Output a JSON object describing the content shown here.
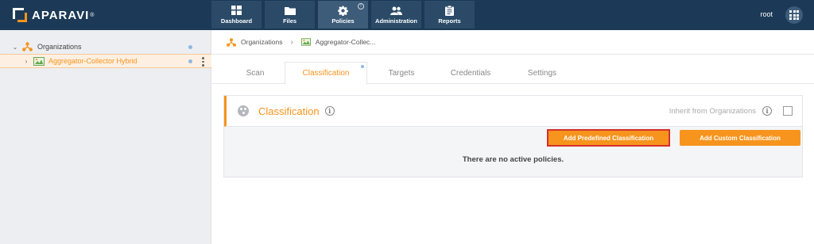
{
  "brand": {
    "name": "APARAVI",
    "reg": "®"
  },
  "nav": {
    "items": [
      {
        "label": "Dashboard",
        "icon": "dashboard-icon"
      },
      {
        "label": "Files",
        "icon": "folder-icon"
      },
      {
        "label": "Policies",
        "icon": "gear-icon",
        "active": true,
        "info": "!"
      },
      {
        "label": "Administration",
        "icon": "users-icon"
      },
      {
        "label": "Reports",
        "icon": "clipboard-icon"
      }
    ]
  },
  "user": {
    "name": "root"
  },
  "tree": {
    "root": {
      "label": "Organizations",
      "chevron": "⌄"
    },
    "child": {
      "label": "Aggregator-Collector Hybrid",
      "chevron": "›"
    }
  },
  "breadcrumb": {
    "items": [
      "Organizations",
      "Aggregator-Collec..."
    ],
    "separator": "›"
  },
  "tabs": [
    "Scan",
    "Classification",
    "Targets",
    "Credentials",
    "Settings"
  ],
  "active_tab": "Classification",
  "panel": {
    "title": "Classification",
    "info": "i",
    "inherit_label": "Inherit from Organizations",
    "add_predefined_label": "Add Predefined Classification",
    "add_custom_label": "Add Custom Classification",
    "empty_message": "There are no active policies."
  },
  "colors": {
    "topbar": "#1c3a57",
    "accent": "#f7941d",
    "highlight_border": "#d3302a",
    "sidebar_bg": "#eceef1"
  }
}
